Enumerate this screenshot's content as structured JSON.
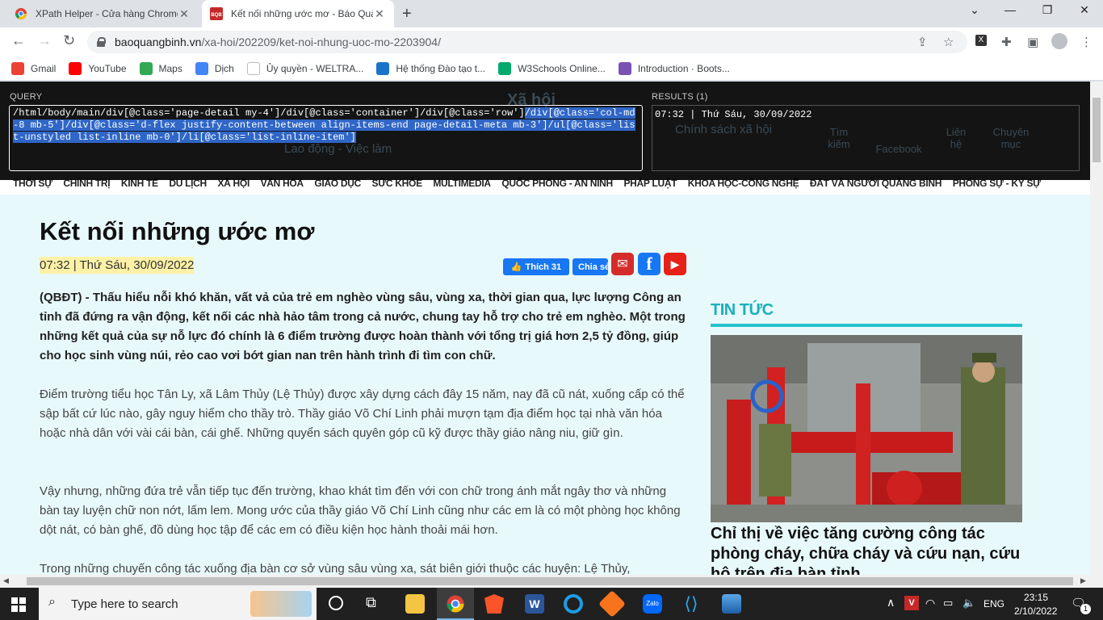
{
  "browser": {
    "tabs": [
      {
        "title": "XPath Helper - Cửa hàng Chrome",
        "active": false
      },
      {
        "title": "Kết nối những ước mơ - Báo Quả",
        "active": true
      }
    ],
    "url_domain": "baoquangbinh.vn",
    "url_path": "/xa-hoi/202209/ket-noi-nhung-uoc-mo-2203904/",
    "bookmarks": [
      "Gmail",
      "YouTube",
      "Maps",
      "Dịch",
      "Ủy quyền - WELTRA...",
      "Hệ thống Đào tạo t...",
      "W3Schools Online...",
      "Introduction · Boots..."
    ]
  },
  "xpath": {
    "query_label": "QUERY",
    "results_label": "RESULTS (1)",
    "query_plain": "/html/body/main/div[@class='page-detail my-4']/div[@class='container']/div[@class='row']",
    "query_selected": "/div[@class='col-md-8 mb-5']/div[@class='d-flex justify-content-between align-items-end page-detail-meta mb-3']/ul[@class='list-unstyled list-inline mb-0']/li[@class='list-inline-item']",
    "result": "07:32 | Thứ Sáu, 30/09/2022"
  },
  "site": {
    "nav": [
      "THỜI SỰ",
      "CHÍNH TRỊ",
      "KINH TẾ",
      "DU LỊCH",
      "XÃ HỘI",
      "VĂN HÓA",
      "GIÁO DỤC",
      "SỨC KHỎE",
      "MULTIMEDIA",
      "QUỐC PHÒNG - AN NINH",
      "PHÁP LUẬT",
      "KHOA HỌC-CÔNG NGHỆ",
      "ĐẤT VÀ NGƯỜI QUẢNG BÌNH",
      "PHÓNG SỰ - KÝ SỰ"
    ],
    "ghost_section": "Xã hội",
    "ghost_sub1": "Chính sách xã hội",
    "ghost_sub2": "Lao động - Việc làm",
    "ghost_icons": [
      "Tìm kiếm",
      "Facebook",
      "Liên hệ",
      "Chuyên mục"
    ]
  },
  "article": {
    "title": "Kết nối những ước mơ",
    "date": "07:32 | Thứ Sáu, 30/09/2022",
    "like_label": "Thích 31",
    "share_label": "Chia sẻ",
    "lead": "(QBĐT) - Thấu hiểu nỗi khó khăn, vất vả của trẻ em nghèo vùng sâu, vùng xa, thời gian qua, lực lượng Công an tỉnh đã đứng ra vận động, kết nối các nhà hảo tâm trong cả nước, chung tay hỗ trợ cho trẻ em nghèo. Một trong những kết quả của sự nỗ lực đó chính là 6 điểm trường được hoàn thành với tổng trị giá hơn 2,5 tỷ đồng, giúp cho học sinh vùng núi, rẻo cao vơi bớt gian nan trên hành trình đi tìm con chữ.",
    "paragraphs": [
      "Điểm trường tiểu học Tân Ly, xã Lâm Thủy (Lệ Thủy) được xây dựng cách đây 15 năm, nay đã cũ nát, xuống cấp có thể sập bất cứ lúc nào, gây nguy hiểm cho thầy trò. Thầy giáo Võ Chí Linh phải mượn tạm địa điểm học tại nhà văn hóa hoặc nhà dân với vài cái bàn, cái ghế. Những quyển sách quyên góp cũ kỹ được thầy giáo nâng niu, giữ gìn.",
      "Vậy nhưng, những đứa trẻ vẫn tiếp tục đến trường, khao khát tìm đến với con chữ trong ánh mắt ngây thơ và những bàn tay luyện chữ non nớt, lấm lem. Mong ước của thầy giáo Võ Chí Linh cũng như các em là có một phòng học không dột nát, có bàn ghế, đồ dùng học tập để các em có điều kiện học hành thoải mái hơn.",
      "Trong những chuyến công tác xuống địa bàn cơ sở vùng sâu vùng xa, sát biên giới thuộc các huyện: Lệ Thủy,"
    ]
  },
  "sidebar": {
    "heading": "TIN TỨC",
    "story_title": "Chỉ thị về việc tăng cường công tác phòng cháy, chữa cháy và cứu nạn, cứu hộ trên địa bàn tỉnh"
  },
  "taskbar": {
    "search_placeholder": "Type here to search",
    "language": "ENG",
    "time": "23:15",
    "date": "2/10/2022",
    "notification_count": "1"
  }
}
